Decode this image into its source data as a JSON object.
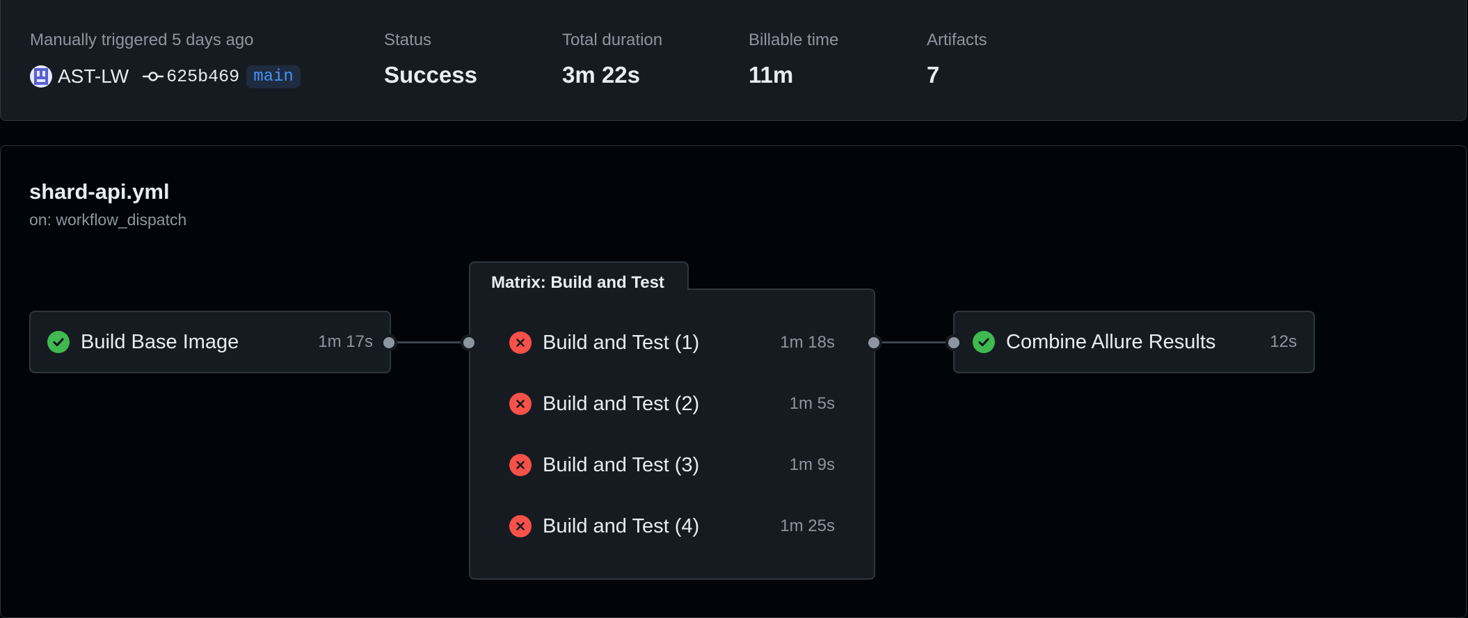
{
  "summary": {
    "trigger_text": "Manually triggered 5 days ago",
    "actor": "AST-LW",
    "commit_sha": "625b469",
    "branch": "main",
    "status_label": "Status",
    "status_value": "Success",
    "duration_label": "Total duration",
    "duration_value": "3m 22s",
    "billable_label": "Billable time",
    "billable_value": "11m",
    "artifacts_label": "Artifacts",
    "artifacts_value": "7"
  },
  "workflow": {
    "file": "shard-api.yml",
    "trigger": "on: workflow_dispatch",
    "jobs": [
      {
        "name": "Build Base Image",
        "time": "1m 17s",
        "status": "success"
      },
      {
        "name": "Combine Allure Results",
        "time": "12s",
        "status": "success"
      }
    ],
    "matrix": {
      "title": "Matrix: Build and Test",
      "items": [
        {
          "name": "Build and Test (1)",
          "time": "1m 18s",
          "status": "failure"
        },
        {
          "name": "Build and Test (2)",
          "time": "1m 5s",
          "status": "failure"
        },
        {
          "name": "Build and Test (3)",
          "time": "1m 9s",
          "status": "failure"
        },
        {
          "name": "Build and Test (4)",
          "time": "1m 25s",
          "status": "failure"
        }
      ]
    }
  },
  "colors": {
    "success": "#3fb950",
    "failure": "#f85149",
    "branch": "#4493f8",
    "background": "#010409",
    "panel": "#161b22"
  },
  "icons": {
    "success": "check-circle-icon",
    "failure": "x-circle-icon",
    "commit": "git-commit-icon"
  }
}
